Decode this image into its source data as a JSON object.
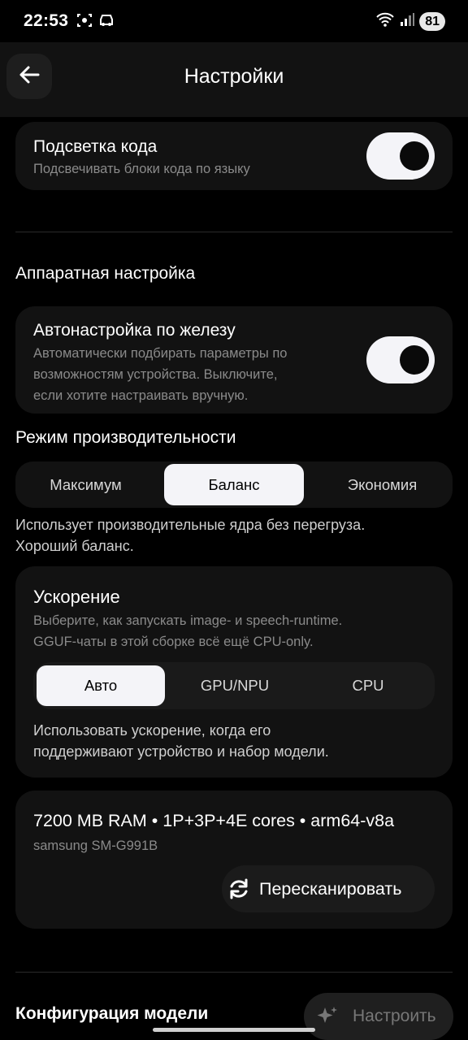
{
  "status": {
    "time": "22:53",
    "battery": "81"
  },
  "appbar": {
    "title": "Настройки"
  },
  "code_highlight": {
    "title": "Подсветка кода",
    "subtitle": "Подсвечивать блоки кода по языку",
    "enabled": true
  },
  "hardware": {
    "section_title": "Аппаратная настройка",
    "auto": {
      "title": "Автонастройка по железу",
      "subtitle_lines": [
        "Автоматически подбирать параметры по",
        "возможностям устройства. Выключите,",
        "если хотите настраивать вручную."
      ],
      "enabled": true
    },
    "performance_label": "Режим производительности",
    "performance_options": [
      "Максимум",
      "Баланс",
      "Экономия"
    ],
    "performance_selected": "Баланс",
    "performance_desc_lines": [
      "Использует производительные ядра без перегруза.",
      "Хороший баланс."
    ],
    "acceleration": {
      "title": "Ускорение",
      "subtitle_lines": [
        "Выберите, как запускать image- и speech-runtime.",
        "GGUF-чаты в этой сборке всё ещё CPU-only."
      ],
      "options": [
        "Авто",
        "GPU/NPU",
        "CPU"
      ],
      "selected": "Авто",
      "desc_lines": [
        "Использовать ускорение, когда его",
        "поддерживают устройство и набор модели."
      ]
    },
    "device": {
      "specs": "7200 MB RAM • 1P+3P+4E cores • arm64-v8a",
      "model": "samsung SM-G991B",
      "rescan_label": "Пересканировать"
    }
  },
  "model_config": {
    "title": "Конфигурация модели",
    "button_label": "Настроить"
  }
}
